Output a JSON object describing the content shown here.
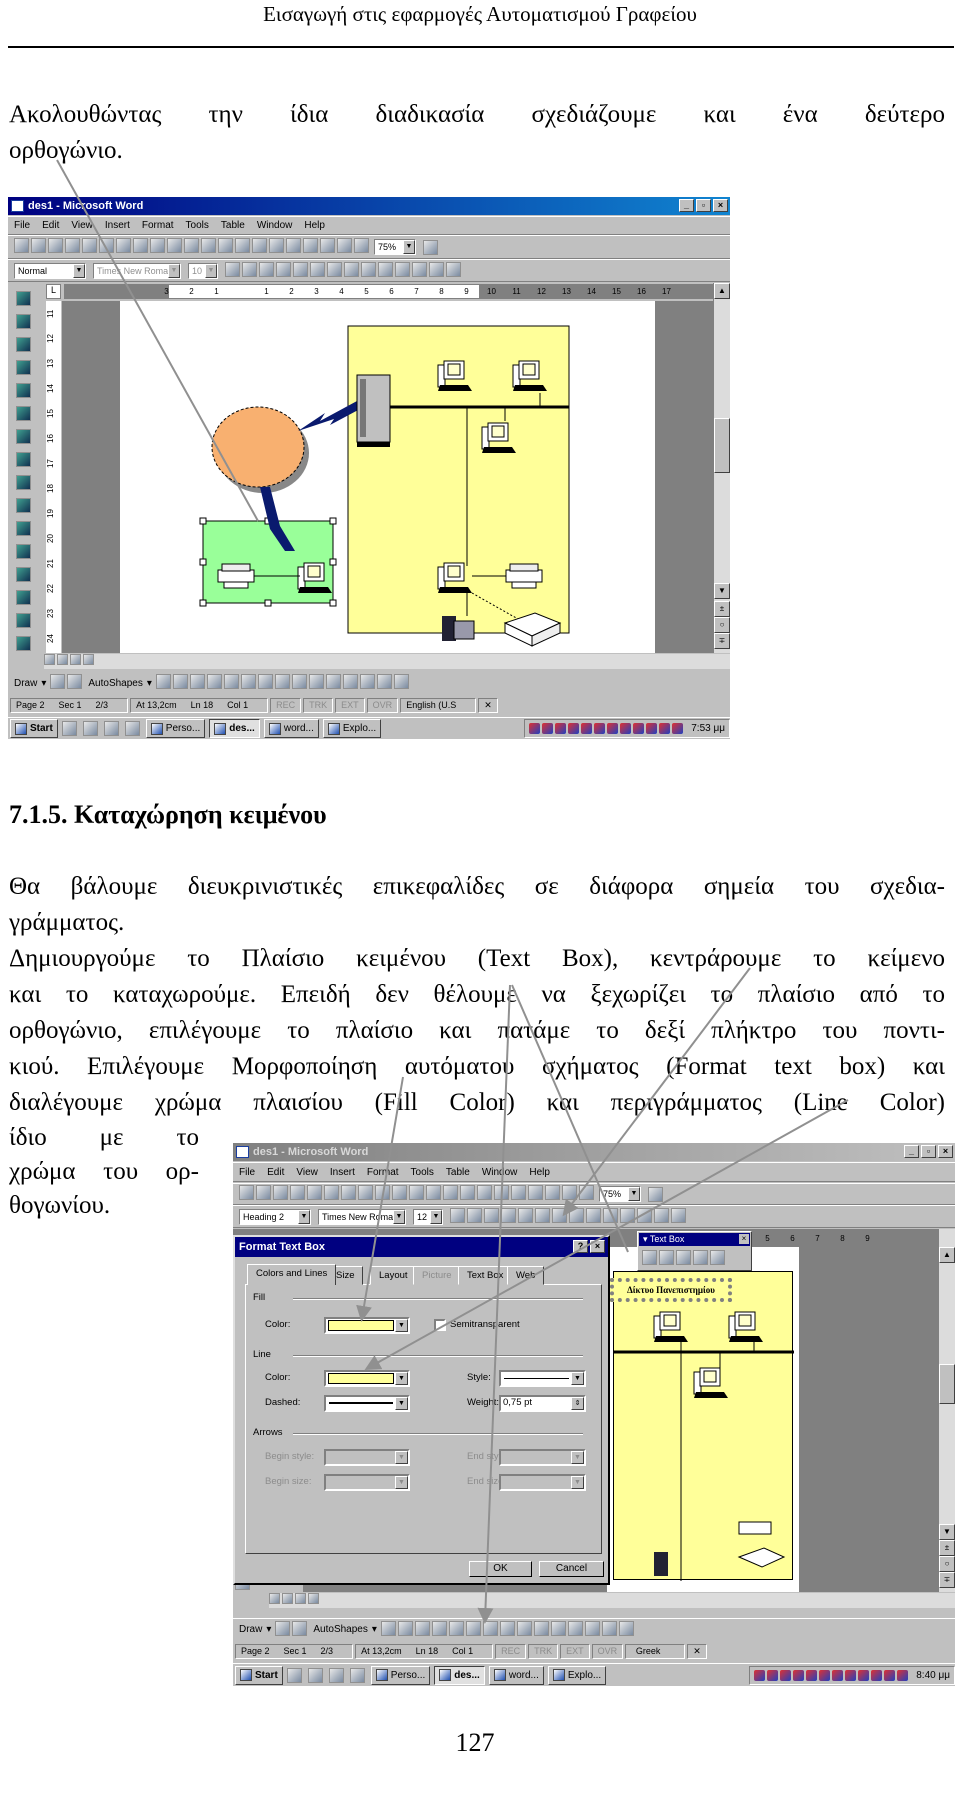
{
  "header": {
    "title": "Εισαγωγή στις εφαρμογές Αυτοματισμού Γραφείου"
  },
  "intro": {
    "lines": [
      "Ακολουθώντας την ίδια διαδικασία σχεδιάζουμε και ένα δεύτερο",
      "ορθογώνιο."
    ]
  },
  "section": {
    "heading": "7.1.5. Καταχώρηση κειμένου",
    "para1": [
      "Θα βάλουμε διευκρινιστικές επικεφαλίδες σε διάφορα σημεία του σχεδια-",
      "γράμματος."
    ],
    "para2": [
      "Δημιουργούμε το Πλαίσιο κειμένου (Text Box), κεντράρουμε το κείμενο",
      "και το καταχωρούμε. Επειδή δεν θέλουμε να ξεχωρίζει το πλαίσιο από το",
      "ορθογώνιο, επιλέγουμε το πλαίσιο και πατάμε το δεξί πλήκτρο του ποντι-",
      "κιού. Επιλέγουμε Μορφοποίηση αυτόματου σχήματος (Format text box) και",
      "διαλέγουμε χρώμα πλαισίου (Fill Color) και περιγράμματος (Line Color)"
    ],
    "para2_wrap": [
      "ίδιο με το",
      "χρώμα του ορ-",
      "θογωνίου."
    ]
  },
  "page_number": "127",
  "colors": {
    "title_active": "#000080",
    "diagram_yellow": "#ffff99",
    "diagram_green": "#99ff99",
    "cloud": "#f8b070",
    "link_navy": "#0a1a6e",
    "arrow_gray": "#909090"
  },
  "word_common": {
    "menu": [
      "File",
      "Edit",
      "View",
      "Insert",
      "Format",
      "Tools",
      "Table",
      "Window",
      "Help"
    ],
    "standard_icons": [
      "new",
      "open",
      "save",
      "permission",
      "print",
      "print-preview",
      "spelling",
      "cut",
      "copy",
      "paste",
      "format-painter",
      "undo",
      "redo",
      "hyperlink",
      "tables-borders",
      "insert-table",
      "insert-excel",
      "columns",
      "drawing",
      "document-map",
      "show-hide"
    ],
    "zoom": "75%",
    "font": "Times New Roman",
    "format_icons": [
      "bold",
      "italic",
      "underline",
      "align-left",
      "align-center",
      "align-right",
      "justify",
      "numbering",
      "bullets",
      "decrease-indent",
      "increase-indent",
      "border",
      "highlight",
      "font-color"
    ],
    "ruler_numbers": [
      "3",
      "2",
      "1",
      "",
      "1",
      "2",
      "3",
      "4",
      "5",
      "6",
      "7",
      "8",
      "9",
      "10",
      "11",
      "12",
      "13",
      "14",
      "15",
      "16",
      "17"
    ],
    "draw_label": "Draw",
    "autoshapes_label": "AutoShapes",
    "draw_icons": [
      "select-objects",
      "free-rotate",
      "line",
      "arrow",
      "rectangle",
      "oval",
      "text-box",
      "wordart",
      "clip-art",
      "fill-color",
      "line-color",
      "font-color",
      "line-style",
      "dash-style",
      "arrow-style",
      "shadow",
      "3d"
    ],
    "start_label": "Start",
    "quicklaunch_icons": [
      "internet-explorer",
      "outlook-express",
      "desktop",
      "channels"
    ],
    "task_buttons": [
      "Perso...",
      "des...",
      "word...",
      "Explo..."
    ],
    "tray_icons": [
      "tray-1",
      "tray-2",
      "tray-3",
      "tray-4",
      "tray-5",
      "tray-6",
      "tray-7",
      "tray-8",
      "tray-9",
      "tray-10",
      "tray-11",
      "tray-12"
    ]
  },
  "screenshot1": {
    "title": "des1 - Microsoft Word",
    "style": "Normal",
    "font_size": "10",
    "vruler_numbers": [
      "11",
      "12",
      "13",
      "14",
      "15",
      "16",
      "17",
      "18",
      "19",
      "20",
      "21",
      "22",
      "23",
      "24"
    ],
    "status": {
      "page": "Page 2",
      "sec": "Sec 1",
      "pages": "2/3",
      "at": "At 13,2cm",
      "ln": "Ln 18",
      "col": "Col 1",
      "rec": "REC",
      "trk": "TRK",
      "ext": "EXT",
      "ovr": "OVR",
      "language": "English (U.S"
    },
    "clock": "7:53 μμ"
  },
  "screenshot2": {
    "title": "des1 - Microsoft Word",
    "style": "Heading 2",
    "font_size": "12",
    "ruler_numbers": [
      "5",
      "6",
      "7",
      "8",
      "9"
    ],
    "textbox_toolbar": {
      "title": "Text Box",
      "icons": [
        "create-link",
        "break-link",
        "previous-textbox",
        "next-textbox",
        "change-text-direction"
      ]
    },
    "textbox_content": "Δίκτυο Πανεπιστημίου",
    "dialog": {
      "title": "Format Text Box",
      "tabs": [
        "Colors and Lines",
        "Size",
        "Layout",
        "Picture",
        "Text Box",
        "Web"
      ],
      "active_tab": "Colors and Lines",
      "fill_section": "Fill",
      "fill_color_label": "Color:",
      "fill_color": "#ffff99",
      "semitransparent_label": "Semitransparent",
      "semitransparent_checked": false,
      "line_section": "Line",
      "line_color_label": "Color:",
      "line_color": "#ffff99",
      "style_label": "Style:",
      "dashed_label": "Dashed:",
      "weight_label": "Weight:",
      "weight_value": "0,75 pt",
      "arrows_section": "Arrows",
      "begin_style_label": "Begin style:",
      "end_style_label": "End style:",
      "begin_size_label": "Begin size:",
      "end_size_label": "End size:",
      "ok_label": "OK",
      "cancel_label": "Cancel"
    },
    "status": {
      "page": "Page 2",
      "sec": "Sec 1",
      "pages": "2/3",
      "at": "At 13,2cm",
      "ln": "Ln 18",
      "col": "Col 1",
      "rec": "REC",
      "trk": "TRK",
      "ext": "EXT",
      "ovr": "OVR",
      "language": "Greek"
    },
    "clock": "8:40 μμ"
  }
}
